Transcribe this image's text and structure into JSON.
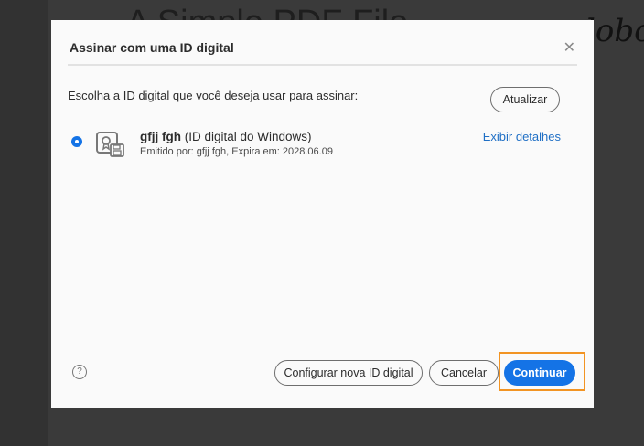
{
  "background": {
    "document_title": "A Simple PDF File",
    "signature": "lobo"
  },
  "dialog": {
    "title": "Assinar com uma ID digital",
    "close_icon": "close-icon",
    "prompt": "Escolha a ID digital que você deseja usar para assinar:",
    "refresh_label": "Atualizar",
    "ids": [
      {
        "name": "gfjj fgh",
        "type": "(ID digital do Windows)",
        "issued": "Emitido por: gfjj fgh, Expira em: 2028.06.09",
        "selected": true,
        "details_label": "Exibir detalhes"
      }
    ],
    "help_icon": "?",
    "configure_label": "Configurar nova ID digital",
    "cancel_label": "Cancelar",
    "continue_label": "Continuar",
    "accent": "#1473e6",
    "highlight": "#f29423"
  }
}
